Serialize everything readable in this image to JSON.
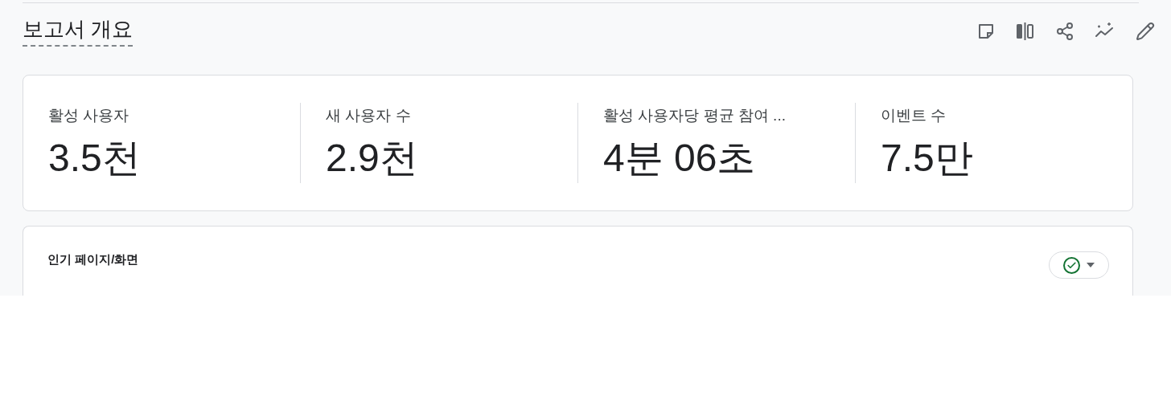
{
  "header": {
    "title": "보고서 개요"
  },
  "metrics": [
    {
      "label": "활성 사용자",
      "value": "3.5천"
    },
    {
      "label": "새 사용자 수",
      "value": "2.9천"
    },
    {
      "label": "활성 사용자당 평균 참여 ...",
      "value": "4분 06초"
    },
    {
      "label": "이벤트 수",
      "value": "7.5만"
    }
  ],
  "top_pages_card": {
    "title": "인기 페이지/화면",
    "status": {
      "ok": true
    }
  }
}
